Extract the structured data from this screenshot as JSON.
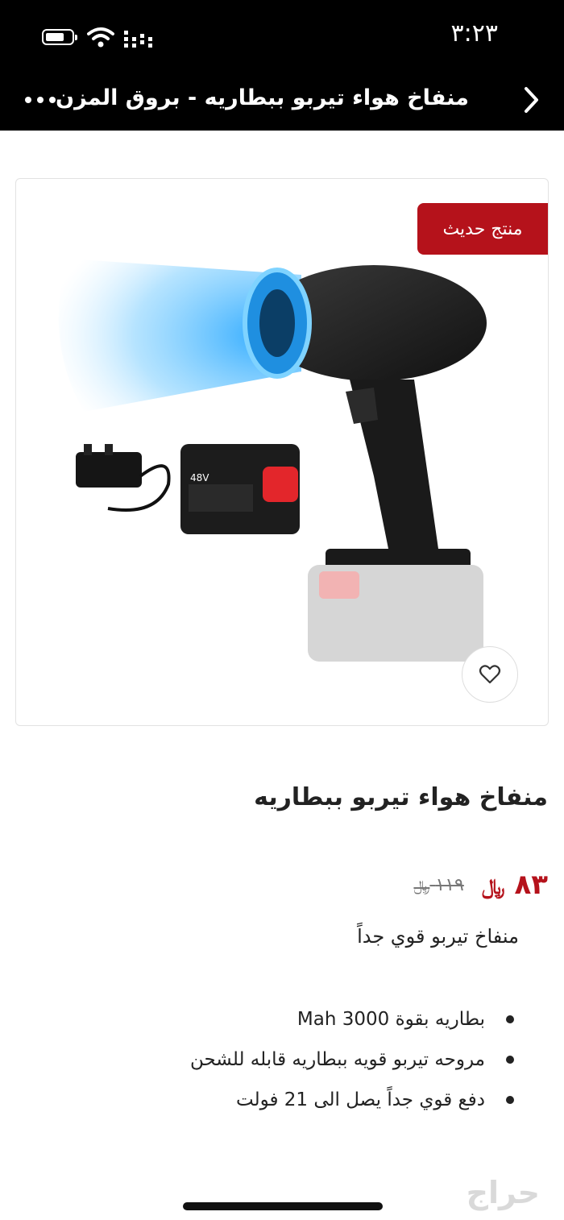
{
  "status_bar": {
    "time": "٣:٢٣"
  },
  "nav": {
    "title": "منفاخ هواء تيربو ببطاريه - بروق المزن"
  },
  "product": {
    "badge": "منتج حديث",
    "title": "منفاخ هواء تيربو ببطاريه",
    "price_now": "٨٣",
    "price_old": "١١٩",
    "description": "منفاخ تيربو قوي جداً",
    "features": [
      "بطاريه بقوة 3000 Mah",
      "مروحه تيربو قويه ببطاريه قابله للشحن",
      "دفع قوي جداً يصل الى 21 فولت"
    ],
    "battery_label": "48V"
  },
  "watermark": "حراج",
  "colors": {
    "accent": "#b5121b",
    "topbar": "#000000"
  },
  "icons": [
    "battery-icon",
    "wifi-icon",
    "signal-icon",
    "back-chevron-icon",
    "more-icon",
    "heart-icon",
    "riyal-icon"
  ]
}
